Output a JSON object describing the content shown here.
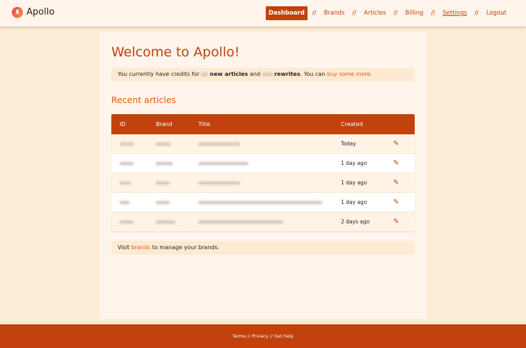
{
  "header": {
    "app_name": "Apollo",
    "nav": [
      "Dashboard",
      "Brands",
      "Articles",
      "Billing",
      "Settings",
      "Logout"
    ],
    "separator": "//"
  },
  "main": {
    "title": "Welcome to Apollo!",
    "credits": {
      "prefix": "You currently have credits for",
      "new_articles": "new articles",
      "and": "and",
      "rewrites": "rewrites",
      "suffix": ". You can",
      "link": "buy some more",
      "end": "."
    },
    "section_title": "Recent articles",
    "table": {
      "headers": [
        "ID",
        "Brand",
        "Title",
        "Created"
      ],
      "rows": [
        {
          "created": "Today"
        },
        {
          "created": "1 day ago"
        },
        {
          "created": "1 day ago"
        },
        {
          "created": "1 day ago"
        },
        {
          "created": "2 days ago"
        }
      ]
    },
    "brands_notice": {
      "prefix": "Visit",
      "link": "brands",
      "suffix": "to manage your brands."
    }
  },
  "footer": {
    "links": [
      "Terms",
      "Privacy",
      "Get help"
    ],
    "separator": "//"
  },
  "colors": {
    "accent": "#c2410c",
    "link": "#ea580c"
  }
}
